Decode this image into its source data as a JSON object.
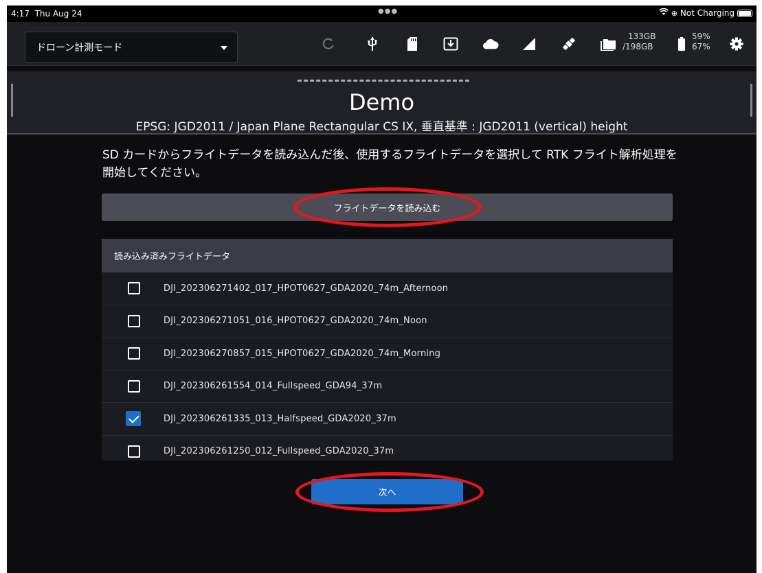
{
  "status_bar": {
    "time": "4:17",
    "date": "Thu Aug 24",
    "charging": "Not Charging"
  },
  "toolbar": {
    "mode_selected": "ドローン計測モード",
    "storage_used": "133GB",
    "storage_total": "/198GB",
    "battery_1": "59%",
    "battery_2": "67%"
  },
  "header": {
    "title": "Demo",
    "crs": "EPSG: JGD2011 / Japan Plane Rectangular CS IX, 垂直基準 : JGD2011 (vertical) height"
  },
  "instructions": "SD カードからフライトデータを読み込んだ後、使用するフライトデータを選択して RTK フライト解析処理を開始してください。",
  "load_button": "フライトデータを読み込む",
  "flight_list": {
    "header": "読み込み済みフライトデータ",
    "items": [
      {
        "label": "DJI_202306271402_017_HPOT0627_GDA2020_74m_Afternoon",
        "checked": false
      },
      {
        "label": "DJI_202306271051_016_HPOT0627_GDA2020_74m_Noon",
        "checked": false
      },
      {
        "label": "DJI_202306270857_015_HPOT0627_GDA2020_74m_Morning",
        "checked": false
      },
      {
        "label": "DJI_202306261554_014_Fullspeed_GDA94_37m",
        "checked": false
      },
      {
        "label": "DJI_202306261335_013_Halfspeed_GDA2020_37m",
        "checked": true
      },
      {
        "label": "DJI_202306261250_012_Fullspeed_GDA2020_37m",
        "checked": false
      }
    ]
  },
  "next_button": "次へ",
  "colors": {
    "accent": "#1f6ec7",
    "annotation": "#e8161c",
    "background": "#0d0d10"
  }
}
